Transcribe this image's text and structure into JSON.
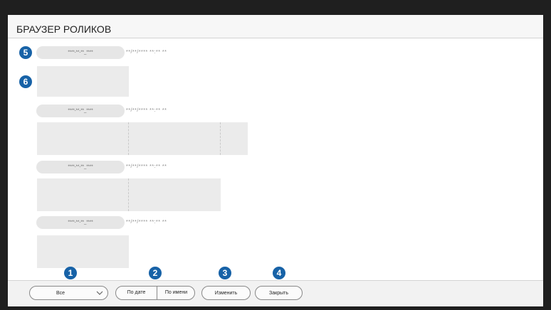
{
  "header": {
    "title": "БРАУЗЕР РОЛИКОВ"
  },
  "groups": [
    {
      "name": "****-**-**_****",
      "datetime": "**/**/**** **:** **",
      "thumbnails": 1
    },
    {
      "name": "****-**-**_****",
      "datetime": "**/**/**** **:** **",
      "thumbnails": 3
    },
    {
      "name": "****-**-**_****",
      "datetime": "**/**/**** **:** **",
      "thumbnails": 2
    },
    {
      "name": "****-**-**_****",
      "datetime": "**/**/**** **:** **",
      "thumbnails": 1
    }
  ],
  "callouts": {
    "c1": "1",
    "c2": "2",
    "c3": "3",
    "c4": "4",
    "c5": "5",
    "c6": "6"
  },
  "toolbar": {
    "filter_selected": "Все",
    "sort_by_date": "По дате",
    "sort_by_name": "По имени",
    "edit_label": "Изменить",
    "close_label": "Закрыть"
  },
  "colors": {
    "badge": "#1762a7",
    "background": "#ffffff",
    "frame": "#1f1f1f"
  }
}
